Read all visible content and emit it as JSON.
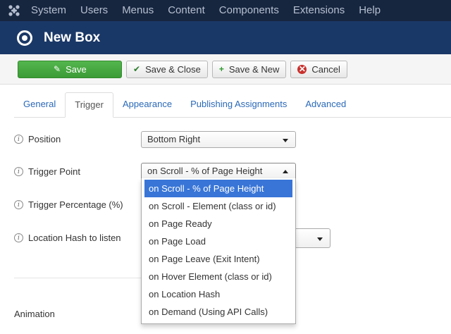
{
  "topnav": {
    "items": [
      "System",
      "Users",
      "Menus",
      "Content",
      "Components",
      "Extensions",
      "Help"
    ]
  },
  "header": {
    "title": "New Box"
  },
  "toolbar": {
    "save": "Save",
    "save_close": "Save & Close",
    "save_new": "Save & New",
    "cancel": "Cancel"
  },
  "tabs": [
    "General",
    "Trigger",
    "Appearance",
    "Publishing Assignments",
    "Advanced"
  ],
  "active_tab": "Trigger",
  "form": {
    "position": {
      "label": "Position",
      "value": "Bottom Right"
    },
    "trigger_point": {
      "label": "Trigger Point",
      "value": "on Scroll - % of Page Height"
    },
    "trigger_percentage": {
      "label": "Trigger Percentage (%)"
    },
    "location_hash": {
      "label": "Location Hash to listen"
    },
    "animation": {
      "label": "Animation"
    }
  },
  "dropdown": {
    "selected_index": 0,
    "options": [
      "on Scroll - % of Page Height",
      "on Scroll - Element (class or id)",
      "on Page Ready",
      "on Page Load",
      "on Page Leave (Exit Intent)",
      "on Hover Element (class or id)",
      "on Location Hash",
      "on Demand (Using API Calls)"
    ]
  },
  "colors": {
    "topnav_bg": "#17263f",
    "titlebar_bg": "#1a3867",
    "save_green": "#46a942",
    "link_blue": "#2a69b8",
    "selected_blue": "#3875d7"
  }
}
